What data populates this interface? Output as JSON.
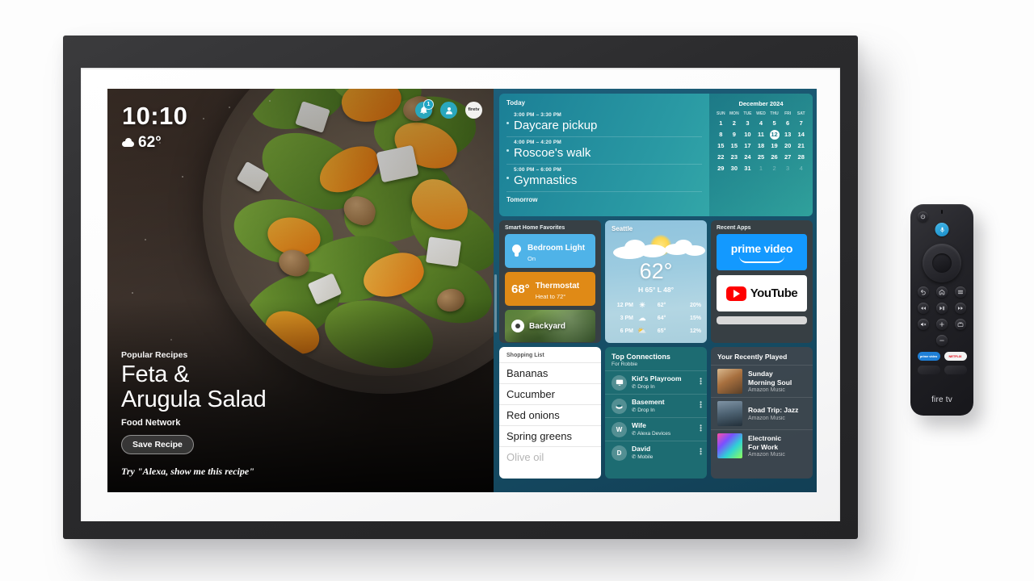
{
  "device": {
    "name": "Amazon Fire TV smart display",
    "camera_module": "camera-module"
  },
  "hero": {
    "clock": "10:10",
    "temperature": "62°",
    "weather_icon": "cloud-icon",
    "status_icons": [
      {
        "name": "notification-bell-icon",
        "badge": "1"
      },
      {
        "name": "profile-avatar-icon",
        "badge": ""
      },
      {
        "name": "firetv-logo-icon",
        "label": "firetv"
      }
    ],
    "kicker": "Popular Recipes",
    "title_line1": "Feta &",
    "title_line2": "Arugula Salad",
    "source": "Food Network",
    "save_button": "Save Recipe",
    "alexa_hint": "Try \"Alexa, show me this recipe\""
  },
  "calendar_card": {
    "today_label": "Today",
    "tomorrow_label": "Tomorrow",
    "events": [
      {
        "time": "3:00 PM – 3:30 PM",
        "name": "Daycare pickup"
      },
      {
        "time": "4:00 PM – 4:20 PM",
        "name": "Roscoe's walk"
      },
      {
        "time": "5:00 PM – 6:00 PM",
        "name": "Gymnastics"
      }
    ],
    "month": "December 2024",
    "dow": [
      "SUN",
      "MON",
      "TUE",
      "WED",
      "THU",
      "FRI",
      "SAT"
    ],
    "today_date": "12",
    "weeks": [
      [
        {
          "d": "1"
        },
        {
          "d": "2"
        },
        {
          "d": "3"
        },
        {
          "d": "4"
        },
        {
          "d": "5"
        },
        {
          "d": "6"
        },
        {
          "d": "7"
        }
      ],
      [
        {
          "d": "8"
        },
        {
          "d": "9"
        },
        {
          "d": "10"
        },
        {
          "d": "11"
        },
        {
          "d": "12",
          "today": true
        },
        {
          "d": "13"
        },
        {
          "d": "14"
        }
      ],
      [
        {
          "d": "15"
        },
        {
          "d": "15"
        },
        {
          "d": "17"
        },
        {
          "d": "18"
        },
        {
          "d": "19"
        },
        {
          "d": "20"
        },
        {
          "d": "21"
        }
      ],
      [
        {
          "d": "22"
        },
        {
          "d": "23"
        },
        {
          "d": "24"
        },
        {
          "d": "25"
        },
        {
          "d": "26"
        },
        {
          "d": "27"
        },
        {
          "d": "28"
        }
      ],
      [
        {
          "d": "29"
        },
        {
          "d": "30"
        },
        {
          "d": "31"
        },
        {
          "d": "1",
          "muted": true
        },
        {
          "d": "2",
          "muted": true
        },
        {
          "d": "3",
          "muted": true
        },
        {
          "d": "4",
          "muted": true
        }
      ]
    ]
  },
  "smart_home": {
    "title": "Smart Home Favorites",
    "light": {
      "name": "Bedroom Light",
      "state": "On",
      "color": "#4fb3e8"
    },
    "thermostat": {
      "temp": "68°",
      "name": "Thermostat",
      "state": "Heat to 72°",
      "color": "#e08a16"
    },
    "camera": {
      "name": "Backyard"
    }
  },
  "weather": {
    "city": "Seattle",
    "temp": "62°",
    "high_low": "H 65°  L 48°",
    "hourly": [
      {
        "time": "12 PM",
        "icon": "☀",
        "temp": "62°",
        "precip": "20%"
      },
      {
        "time": "3 PM",
        "icon": "☁",
        "temp": "64°",
        "precip": "15%"
      },
      {
        "time": "6 PM",
        "icon": "⛅",
        "temp": "65°",
        "precip": "12%"
      }
    ]
  },
  "recent_apps": {
    "title": "Recent Apps",
    "apps": [
      {
        "name": "prime video",
        "color": "#1399ff"
      },
      {
        "name": "YouTube",
        "color": "#ffffff"
      }
    ]
  },
  "shopping_list": {
    "title": "Shopping List",
    "items": [
      {
        "text": "Bananas",
        "faded": false
      },
      {
        "text": "Cucumber",
        "faded": false
      },
      {
        "text": "Red onions",
        "faded": false
      },
      {
        "text": "Spring greens",
        "faded": false
      },
      {
        "text": "Olive oil",
        "faded": true
      }
    ]
  },
  "connections": {
    "title": "Top Connections",
    "subtitle": "For Robbie",
    "rows": [
      {
        "initial": "",
        "icon": "monitor-icon",
        "name": "Kid's Playroom",
        "mode": "Drop In",
        "mode_icon": "home-icon"
      },
      {
        "initial": "",
        "icon": "echo-dot-icon",
        "name": "Basement",
        "mode": "Drop In",
        "mode_icon": "phone-icon"
      },
      {
        "initial": "W",
        "icon": "",
        "name": "Wife",
        "mode": "Alexa Devices",
        "mode_icon": "phone-icon"
      },
      {
        "initial": "D",
        "icon": "",
        "name": "David",
        "mode": "Mobile",
        "mode_icon": "phone-icon"
      }
    ]
  },
  "recently_played": {
    "title": "Your Recently Played",
    "rows": [
      {
        "name": "Sunday\nMorning Soul",
        "name1": "Sunday",
        "name2": "Morning Soul",
        "service": "Amazon Music",
        "art": "#c9a externally"
      },
      {
        "name1": "Road Trip: Jazz",
        "name2": "",
        "service": "Amazon Music"
      },
      {
        "name1": "Electronic",
        "name2": "For Work",
        "service": "Amazon Music"
      }
    ]
  },
  "remote": {
    "buttons": [
      {
        "name": "power-button",
        "glyph": "⏻"
      },
      {
        "name": "voice-mic-button",
        "glyph": "🎤"
      },
      {
        "name": "back-button",
        "glyph": "↰"
      },
      {
        "name": "home-button",
        "glyph": "⌂"
      },
      {
        "name": "menu-button",
        "glyph": "☰"
      },
      {
        "name": "rewind-button",
        "glyph": "◀◀"
      },
      {
        "name": "play-pause-button",
        "glyph": "▶❚"
      },
      {
        "name": "fast-forward-button",
        "glyph": "▶▶"
      },
      {
        "name": "mute-button",
        "glyph": "🔇"
      },
      {
        "name": "volume-up-button",
        "glyph": "＋"
      },
      {
        "name": "guide-button",
        "glyph": "📺"
      },
      {
        "name": "volume-down-button",
        "glyph": "－"
      }
    ],
    "app_buttons": [
      {
        "name": "prime video",
        "color": "#1f7fd6"
      },
      {
        "name": "NETFLIX",
        "color": "#e50914"
      }
    ],
    "brand": "fire tv"
  }
}
